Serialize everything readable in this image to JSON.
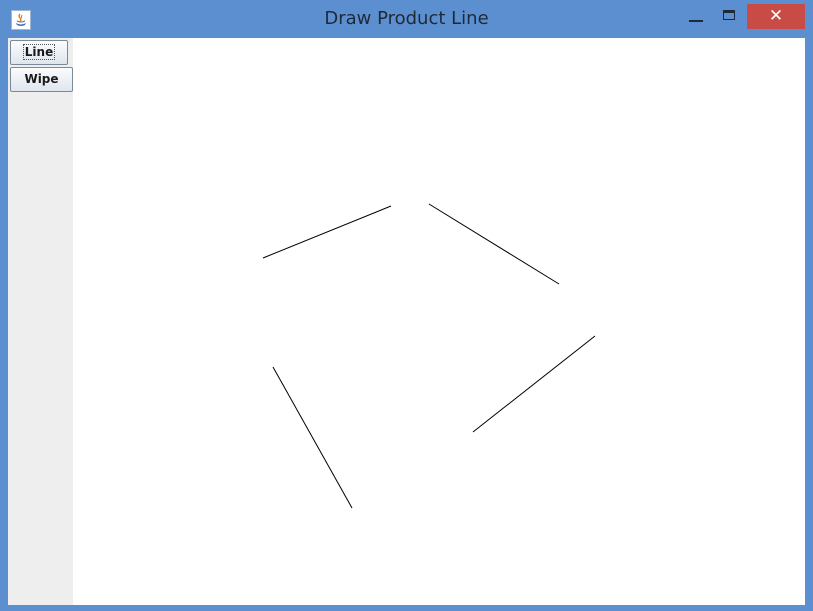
{
  "window": {
    "title": "Draw Product Line",
    "close_glyph": "✕"
  },
  "toolbar": {
    "line_label": "Line",
    "wipe_label": "Wipe"
  },
  "colors": {
    "titlebar": "#5b8fd0",
    "close_button": "#c84b45",
    "side_panel": "#eeeeee",
    "canvas": "#ffffff",
    "stroke": "#000000"
  },
  "icons": {
    "app": "java-coffee-cup-icon",
    "minimize": "minimize-icon",
    "maximize": "maximize-icon",
    "close": "close-icon"
  }
}
